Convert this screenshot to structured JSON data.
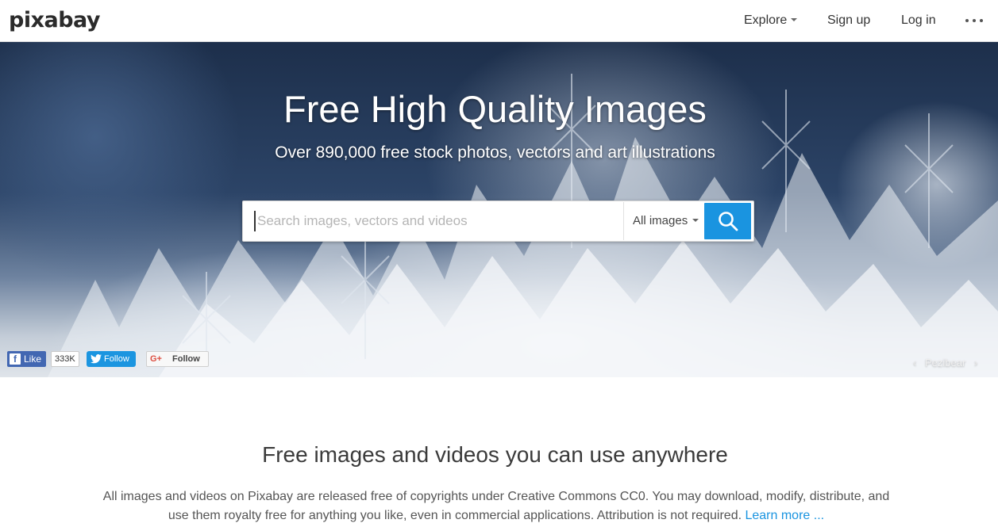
{
  "header": {
    "logo": "pixabay",
    "nav": {
      "explore": "Explore",
      "signup": "Sign up",
      "login": "Log in"
    },
    "more_icon": "ellipsis-icon"
  },
  "hero": {
    "title": "Free High Quality Images",
    "subtitle": "Over 890,000 free stock photos, vectors and art illustrations",
    "search": {
      "placeholder": "Search images, vectors and videos",
      "value": "",
      "type_selected": "All images",
      "button_icon": "search-icon"
    },
    "social": {
      "fb_label": "Like",
      "fb_count": "333K",
      "twitter_label": "Follow",
      "gplus_label": "Follow",
      "gplus_icon_text": "G+"
    },
    "credit": {
      "prev": "‹",
      "name": "Pezibear",
      "next": "›"
    }
  },
  "intro": {
    "title": "Free images and videos you can use anywhere",
    "text": "All images and videos on Pixabay are released free of copyrights under Creative Commons CC0. You may download, modify, distribute, and use them royalty free for anything you like, even in commercial applications. Attribution is not required.",
    "link": "Learn more ..."
  },
  "colors": {
    "accent": "#1a94e0",
    "facebook": "#4267b2",
    "twitter": "#1b95e0"
  }
}
